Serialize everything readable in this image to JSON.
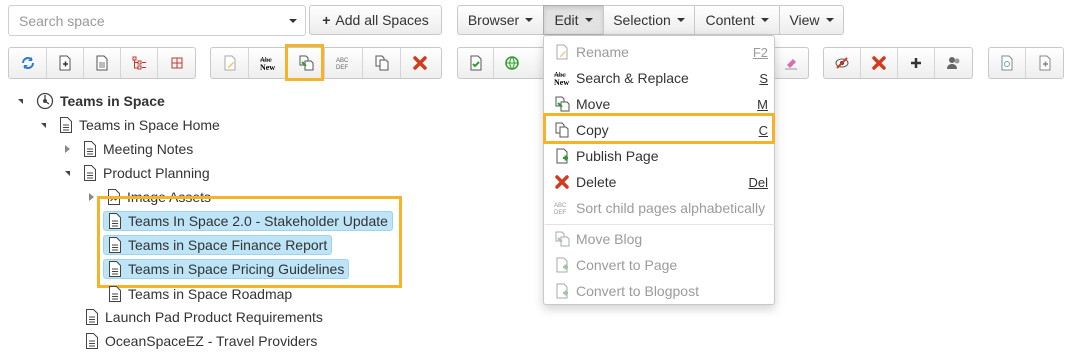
{
  "search": {
    "placeholder": "Search space"
  },
  "toolbar": {
    "add_all_spaces": "Add all Spaces",
    "menus": [
      "Browser",
      "Edit",
      "Selection",
      "Content",
      "View"
    ]
  },
  "toolbar_icons": {
    "group1": [
      "refresh-icon",
      "add-page-icon",
      "page-icon",
      "tree-icon",
      "tree-red-icon"
    ],
    "group2": [
      "rename-icon",
      "search-replace-icon",
      "move-icon",
      "sort-icon",
      "copy-icon",
      "delete-icon"
    ],
    "group3": [
      "approve-icon",
      "globe-icon"
    ],
    "group4": [
      "eraser-icon"
    ],
    "group5": [
      "watch-icon",
      "remove-icon",
      "add-icon",
      "users-icon"
    ],
    "group6": [
      "preview-icon",
      "export-icon"
    ]
  },
  "tree": {
    "root": "Teams in Space",
    "home": "Teams in Space Home",
    "meeting_notes": "Meeting Notes",
    "product_planning": "Product Planning",
    "image_assets": "Image Assets",
    "selected": [
      "Teams In Space 2.0 - Stakeholder Update",
      "Teams in Space Finance Report",
      "Teams in Space Pricing Guidelines"
    ],
    "roadmap": "Teams in Space Roadmap",
    "launch_pad": "Launch Pad Product Requirements",
    "oceanspace": "OceanSpaceEZ - Travel Providers"
  },
  "edit_menu": {
    "items": [
      {
        "label": "Rename",
        "shortcut": "F2",
        "icon": "rename-icon",
        "disabled": true
      },
      {
        "label": "Search & Replace",
        "shortcut": "S",
        "icon": "search-replace-icon",
        "disabled": false
      },
      {
        "label": "Move",
        "shortcut": "M",
        "icon": "move-icon",
        "disabled": false
      },
      {
        "label": "Copy",
        "shortcut": "C",
        "icon": "copy-icon",
        "disabled": false
      },
      {
        "label": "Publish Page",
        "shortcut": "",
        "icon": "publish-icon",
        "disabled": false
      },
      {
        "label": "Delete",
        "shortcut": "Del",
        "icon": "delete-icon",
        "disabled": false
      },
      {
        "label": "Sort child pages alphabetically",
        "shortcut": "",
        "icon": "sort-icon",
        "disabled": true
      },
      {
        "label": "Move Blog",
        "shortcut": "",
        "icon": "move-blog-icon",
        "disabled": true
      },
      {
        "label": "Convert to Page",
        "shortcut": "",
        "icon": "convert-page-icon",
        "disabled": true
      },
      {
        "label": "Convert to Blogpost",
        "shortcut": "",
        "icon": "convert-blog-icon",
        "disabled": true
      }
    ]
  },
  "colors": {
    "highlight": "#f4b42a",
    "selection": "#bde4f7"
  }
}
